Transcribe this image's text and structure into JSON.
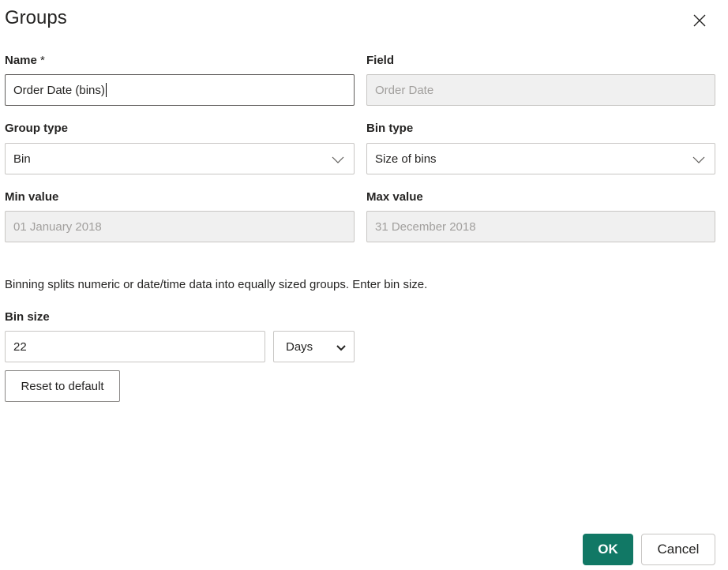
{
  "dialog": {
    "title": "Groups",
    "close_icon": "close-icon"
  },
  "fields": {
    "name": {
      "label": "Name",
      "required_marker": "*",
      "value": "Order Date (bins)"
    },
    "field": {
      "label": "Field",
      "value": "Order Date"
    },
    "group_type": {
      "label": "Group type",
      "value": "Bin",
      "icon": "chevron-down-icon"
    },
    "bin_type": {
      "label": "Bin type",
      "value": "Size of bins",
      "icon": "chevron-down-icon"
    },
    "min_value": {
      "label": "Min value",
      "value": "01 January 2018"
    },
    "max_value": {
      "label": "Max value",
      "value": "31 December 2018"
    },
    "description": "Binning splits numeric or date/time data into equally sized groups. Enter bin size.",
    "bin_size": {
      "label": "Bin size",
      "value": "22",
      "unit": "Days"
    }
  },
  "buttons": {
    "reset": "Reset to default",
    "ok": "OK",
    "cancel": "Cancel"
  },
  "colors": {
    "primary": "#117865"
  }
}
